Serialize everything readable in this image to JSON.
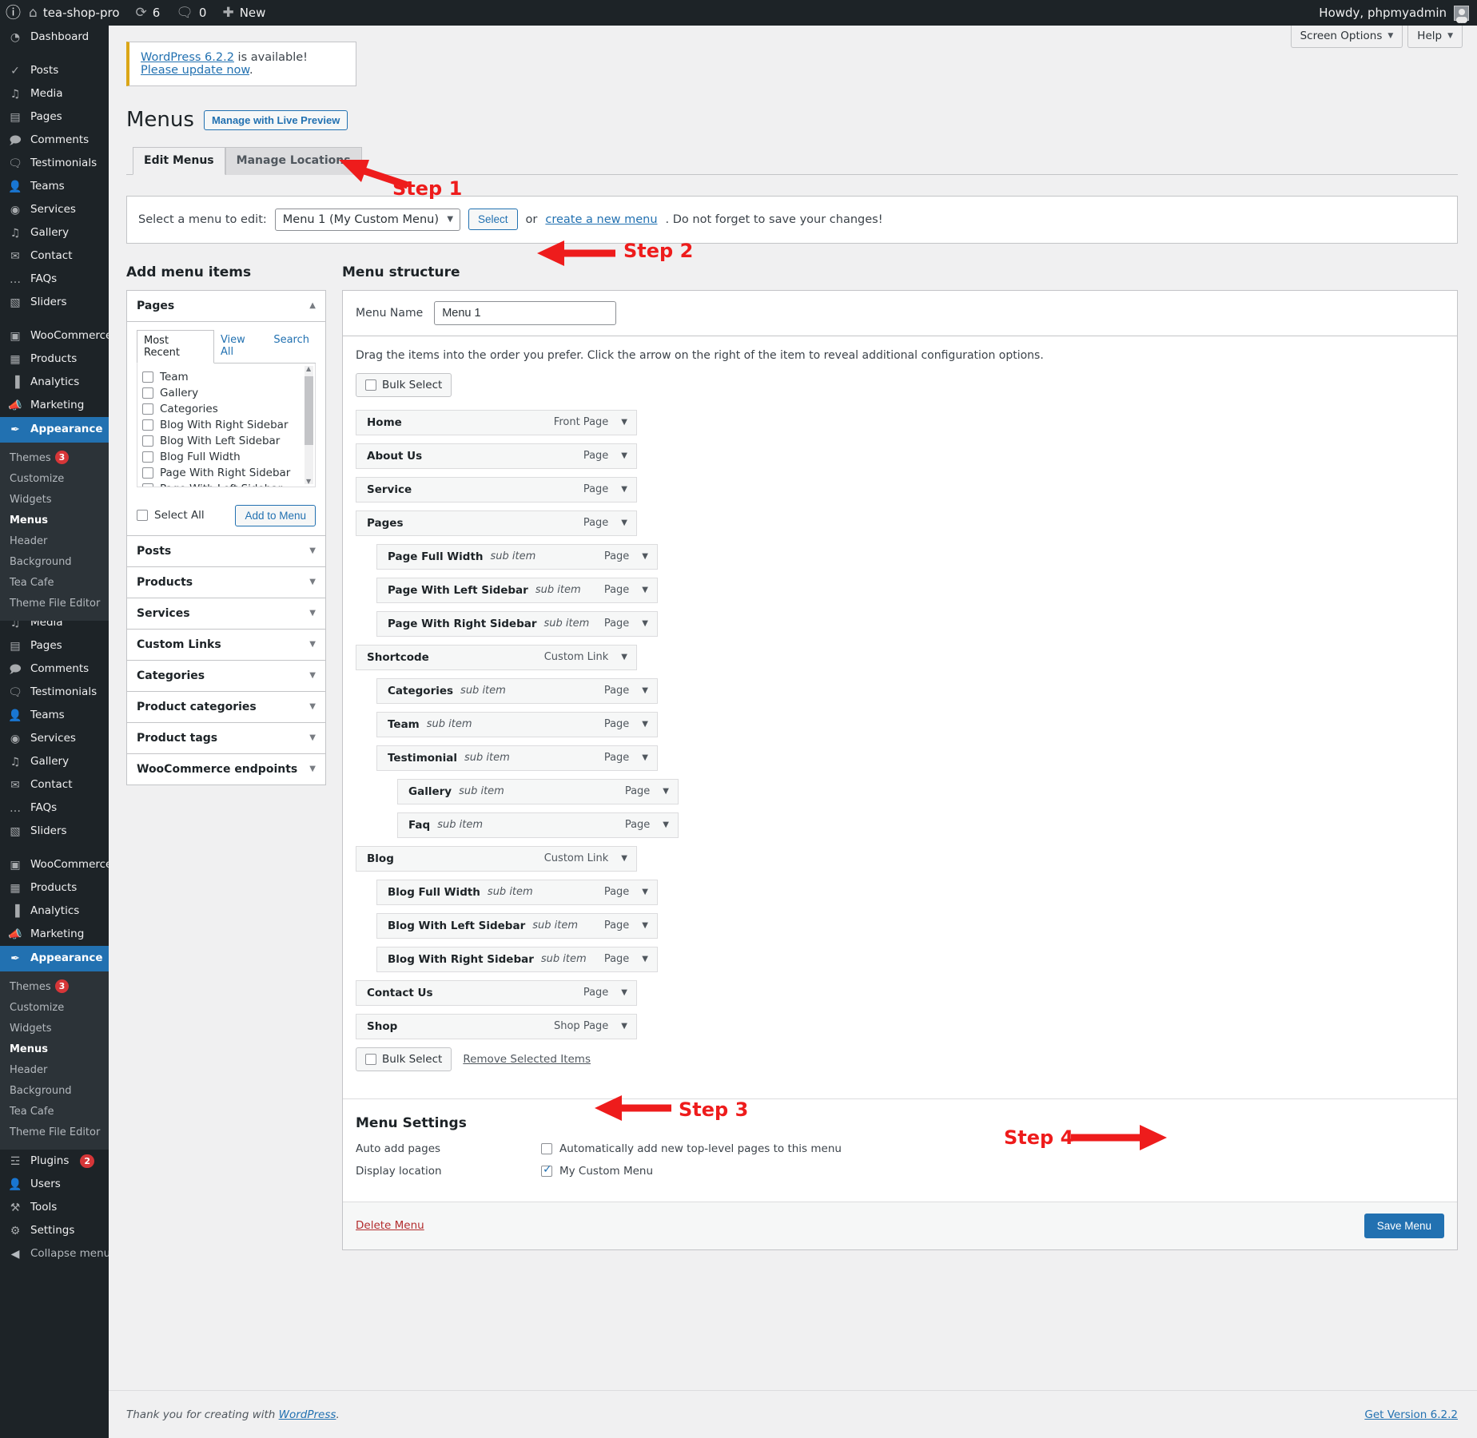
{
  "adminbar": {
    "logo_icon": "wordpress-logo-icon",
    "site_icon": "home-icon",
    "site_name": "tea-shop-pro",
    "updates_icon": "updates-icon",
    "updates_count": "6",
    "comments_icon": "comment-bubble-icon",
    "comments_count": "0",
    "new_icon": "plus-icon",
    "new_label": "New",
    "howdy": "Howdy, phpmyadmin"
  },
  "screen_meta": {
    "screen_options": "Screen Options",
    "help": "Help"
  },
  "sidebar": {
    "items": [
      {
        "label": "Dashboard",
        "icon": "dashboard-icon"
      },
      {
        "label": "Posts",
        "icon": "pin-icon",
        "sep": true
      },
      {
        "label": "Media",
        "icon": "media-icon"
      },
      {
        "label": "Pages",
        "icon": "pages-icon"
      },
      {
        "label": "Comments",
        "icon": "comments-icon"
      },
      {
        "label": "Testimonials",
        "icon": "testimonials-icon"
      },
      {
        "label": "Teams",
        "icon": "teams-icon"
      },
      {
        "label": "Services",
        "icon": "services-icon"
      },
      {
        "label": "Gallery",
        "icon": "gallery-icon"
      },
      {
        "label": "Contact",
        "icon": "envelope-icon"
      },
      {
        "label": "FAQs",
        "icon": "faq-icon"
      },
      {
        "label": "Sliders",
        "icon": "sliders-icon"
      },
      {
        "label": "WooCommerce",
        "icon": "woocommerce-icon",
        "sep": true
      },
      {
        "label": "Products",
        "icon": "products-icon"
      },
      {
        "label": "Analytics",
        "icon": "analytics-icon"
      },
      {
        "label": "Marketing",
        "icon": "marketing-icon"
      },
      {
        "label": "Appearance",
        "icon": "appearance-brush-icon",
        "current": true
      }
    ],
    "appearance_submenu": [
      {
        "label": "Themes",
        "badge": "3"
      },
      {
        "label": "Customize"
      },
      {
        "label": "Widgets"
      },
      {
        "label": "Menus",
        "active": true
      },
      {
        "label": "Header"
      },
      {
        "label": "Background"
      },
      {
        "label": "Tea Cafe"
      },
      {
        "label": "Theme File Editor"
      }
    ],
    "bottom_items": [
      {
        "label": "Plugins",
        "icon": "plugin-icon",
        "badge": "2"
      },
      {
        "label": "Users",
        "icon": "user-icon"
      },
      {
        "label": "Tools",
        "icon": "wrench-icon"
      },
      {
        "label": "Settings",
        "icon": "settings-sliders-icon"
      }
    ],
    "collapse": {
      "label": "Collapse menu",
      "icon": "collapse-arrow-icon"
    }
  },
  "notice": {
    "link1": "WordPress 6.2.2",
    "mid": " is available! ",
    "link2": "Please update now",
    "end": "."
  },
  "header": {
    "title": "Menus",
    "live_preview_button": "Manage with Live Preview"
  },
  "tabs": [
    {
      "label": "Edit Menus",
      "active": true
    },
    {
      "label": "Manage Locations",
      "active": false
    }
  ],
  "select_menu": {
    "label": "Select a menu to edit:",
    "value": "Menu 1 (My Custom Menu)",
    "caret_icon": "chevron-down-icon",
    "select_button": "Select",
    "or_text": "or ",
    "create_link": "create a new menu",
    "tail_text": ". Do not forget to save your changes!"
  },
  "add_items": {
    "title": "Add menu items",
    "pages_panel": {
      "label": "Pages",
      "toggle_icon": "chevron-up-icon",
      "tabs": [
        {
          "label": "Most Recent",
          "on": true
        },
        {
          "label": "View All",
          "on": false
        },
        {
          "label": "Search",
          "on": false
        }
      ],
      "pages": [
        "Team",
        "Gallery",
        "Categories",
        "Blog With Right Sidebar",
        "Blog With Left Sidebar",
        "Blog Full Width",
        "Page With Right Sidebar",
        "Page With Left Sidebar"
      ],
      "select_all": "Select All",
      "add_to_menu": "Add to Menu"
    },
    "panels": [
      "Posts",
      "Products",
      "Services",
      "Custom Links",
      "Categories",
      "Product categories",
      "Product tags",
      "WooCommerce endpoints"
    ]
  },
  "structure": {
    "title": "Menu structure",
    "menu_name_label": "Menu Name",
    "menu_name_value": "Menu 1",
    "hint": "Drag the items into the order you prefer. Click the arrow on the right of the item to reveal additional configuration options.",
    "bulk_select": "Bulk Select",
    "remove_selected": "Remove Selected Items",
    "items": [
      {
        "name": "Home",
        "sub": "",
        "type": "Front Page",
        "depth": 0
      },
      {
        "name": "About Us",
        "sub": "",
        "type": "Page",
        "depth": 0
      },
      {
        "name": "Service",
        "sub": "",
        "type": "Page",
        "depth": 0
      },
      {
        "name": "Pages",
        "sub": "",
        "type": "Page",
        "depth": 0
      },
      {
        "name": "Page Full Width",
        "sub": "sub item",
        "type": "Page",
        "depth": 1
      },
      {
        "name": "Page With Left Sidebar",
        "sub": "sub item",
        "type": "Page",
        "depth": 1
      },
      {
        "name": "Page With Right Sidebar",
        "sub": "sub item",
        "type": "Page",
        "depth": 1
      },
      {
        "name": "Shortcode",
        "sub": "",
        "type": "Custom Link",
        "depth": 0
      },
      {
        "name": "Categories",
        "sub": "sub item",
        "type": "Page",
        "depth": 1
      },
      {
        "name": "Team",
        "sub": "sub item",
        "type": "Page",
        "depth": 1
      },
      {
        "name": "Testimonial",
        "sub": "sub item",
        "type": "Page",
        "depth": 1
      },
      {
        "name": "Gallery",
        "sub": "sub item",
        "type": "Page",
        "depth": 2
      },
      {
        "name": "Faq",
        "sub": "sub item",
        "type": "Page",
        "depth": 2
      },
      {
        "name": "Blog",
        "sub": "",
        "type": "Custom Link",
        "depth": 0
      },
      {
        "name": "Blog Full Width",
        "sub": "sub item",
        "type": "Page",
        "depth": 1
      },
      {
        "name": "Blog With Left Sidebar",
        "sub": "sub item",
        "type": "Page",
        "depth": 1
      },
      {
        "name": "Blog With Right Sidebar",
        "sub": "sub item",
        "type": "Page",
        "depth": 1
      },
      {
        "name": "Contact Us",
        "sub": "",
        "type": "Page",
        "depth": 0
      },
      {
        "name": "Shop",
        "sub": "",
        "type": "Shop Page",
        "depth": 0
      }
    ]
  },
  "menu_settings": {
    "title": "Menu Settings",
    "auto_add_label": "Auto add pages",
    "auto_add_text": "Automatically add new top-level pages to this menu",
    "auto_add_checked": false,
    "display_loc_label": "Display location",
    "display_loc_text": "My Custom Menu",
    "display_loc_checked": true
  },
  "save_bar": {
    "delete_menu": "Delete Menu",
    "save_menu": "Save Menu"
  },
  "annotations": {
    "step1": "Step 1",
    "step2": "Step 2",
    "step3": "Step 3",
    "step4": "Step 4",
    "color": "#ee1c1c"
  },
  "footer": {
    "thanks_pre": "Thank you for creating with ",
    "thanks_link": "WordPress",
    "thanks_post": ".",
    "version": "Get Version 6.2.2"
  }
}
